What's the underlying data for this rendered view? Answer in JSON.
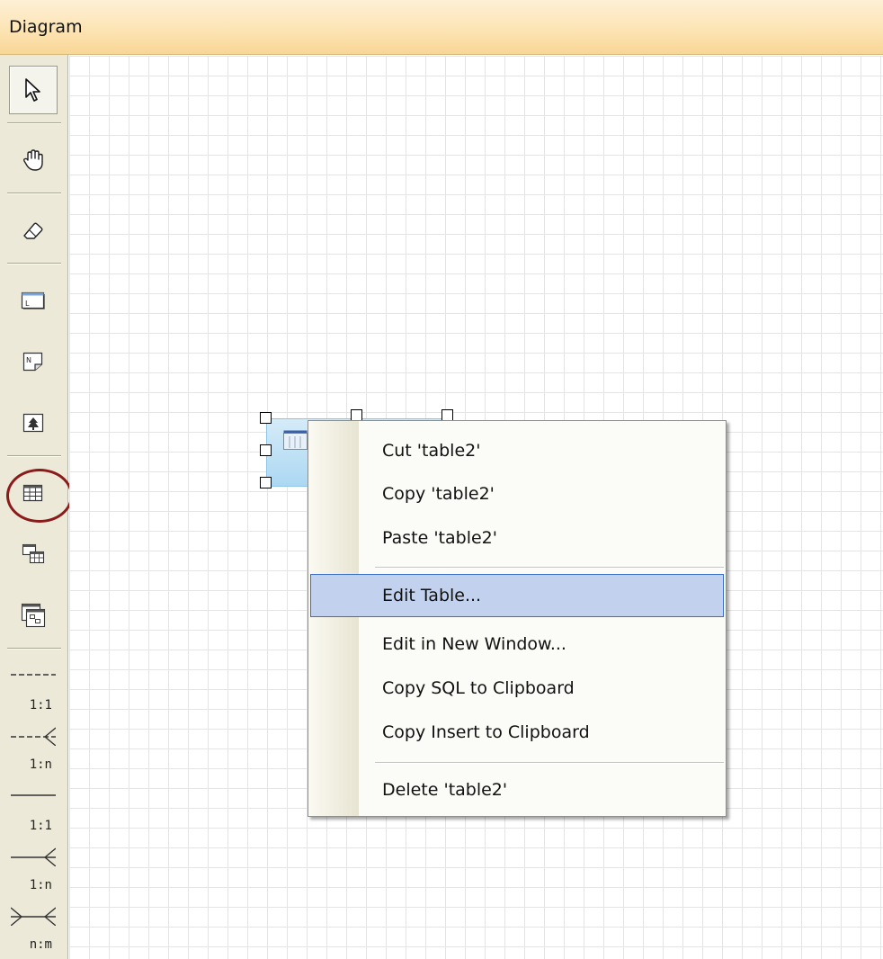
{
  "panel": {
    "title": "Diagram"
  },
  "toolbar": {
    "tools": [
      {
        "name": "select-tool",
        "icon": "pointer-arrow-icon"
      },
      {
        "name": "pan-tool",
        "icon": "hand-icon"
      },
      {
        "name": "eraser-tool",
        "icon": "eraser-icon"
      },
      {
        "name": "label-tool",
        "icon": "label-box-icon"
      },
      {
        "name": "note-tool",
        "icon": "note-icon"
      },
      {
        "name": "image-tool",
        "icon": "image-icon"
      },
      {
        "name": "table-tool",
        "icon": "table-icon"
      },
      {
        "name": "view-tool",
        "icon": "view-icon"
      },
      {
        "name": "layer-tool",
        "icon": "layer-icon"
      }
    ],
    "relations": [
      {
        "label": "1:1",
        "style": "dashed-one-to-one"
      },
      {
        "label": "1:n",
        "style": "dashed-one-to-many"
      },
      {
        "label": "1:1",
        "style": "solid-one-to-one"
      },
      {
        "label": "1:n",
        "style": "solid-one-to-many"
      },
      {
        "label": "n:m",
        "style": "solid-many-to-many"
      }
    ],
    "highlight_color": "#8b1a1a"
  },
  "context_menu": {
    "items": [
      {
        "label": "Cut 'table2'"
      },
      {
        "label": "Copy 'table2'"
      },
      {
        "label": "Paste 'table2'"
      },
      {
        "label": "Edit Table..."
      },
      {
        "label": "Edit in New Window..."
      },
      {
        "label": "Copy SQL to Clipboard"
      },
      {
        "label": "Copy Insert to Clipboard"
      },
      {
        "label": "Delete 'table2'"
      }
    ],
    "hovered_item": "Edit Table...",
    "hover_color": "#c2d2ee"
  }
}
